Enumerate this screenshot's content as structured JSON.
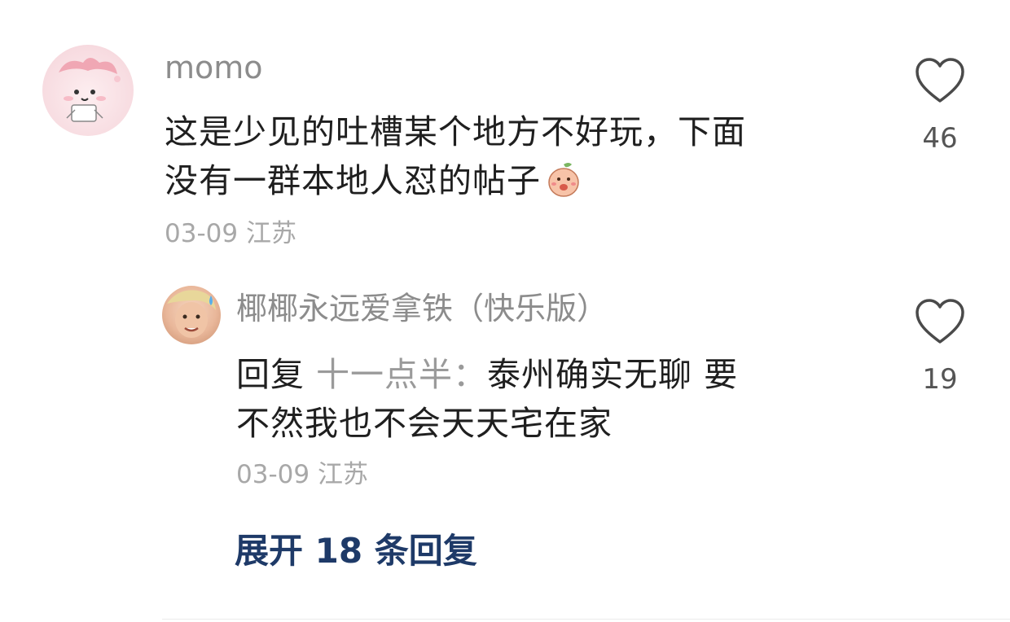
{
  "comment": {
    "username": "momo",
    "text_line1": "这是少见的吐槽某个地方不好玩，下面",
    "text_line2": "没有一群本地人怼的帖子",
    "emoji_icon": "blushing-peach-emoji-icon",
    "date": "03-09",
    "location": "江苏",
    "likes": "46"
  },
  "reply": {
    "username": "椰椰永远爱拿铁（快乐版）",
    "prefix": "回复",
    "mention": "十一点半：",
    "text_line1_rest": "泰州确实无聊 要",
    "text_line2": "不然我也不会天天宅在家",
    "date": "03-09",
    "location": "江苏",
    "likes": "19"
  },
  "expand_label": "展开 18 条回复",
  "colors": {
    "username": "#8c8c8c",
    "meta": "#a8a8a8",
    "expand_link": "#1e3a68"
  }
}
